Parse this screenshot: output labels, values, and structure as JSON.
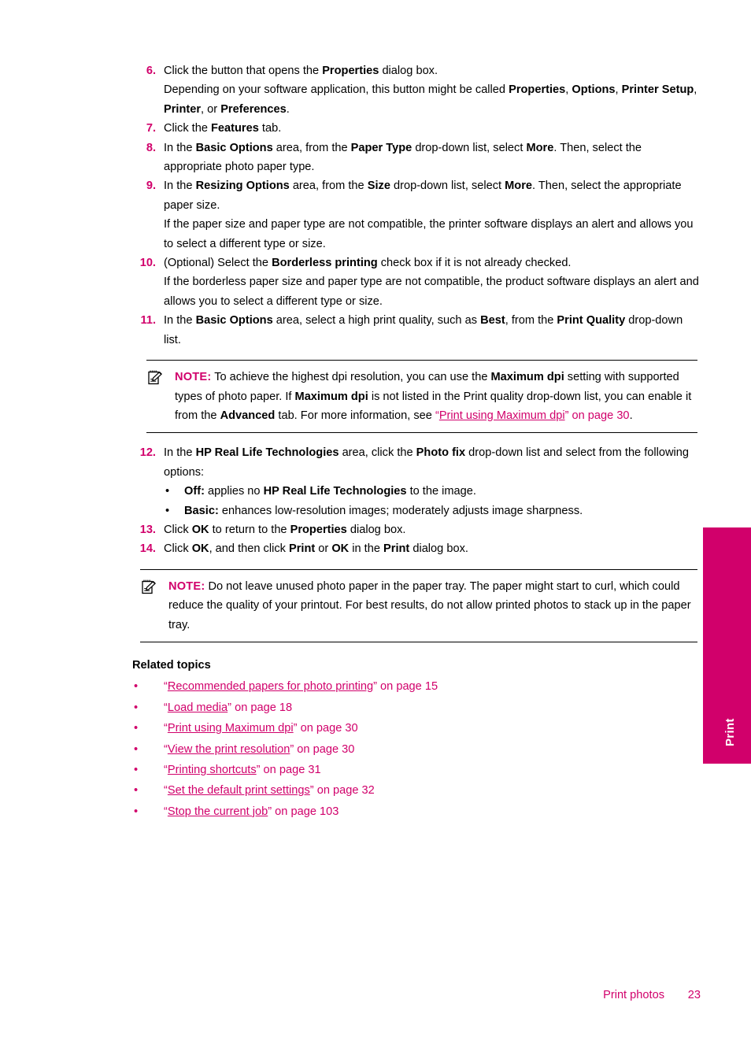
{
  "document": {
    "side_tab_label": "Print",
    "footer": {
      "section": "Print photos",
      "page_number": "23"
    },
    "accent_color": "#D1006B"
  },
  "steps": [
    {
      "number": "6.",
      "paragraphs": [
        {
          "runs": [
            {
              "t": "Click the button that opens the ",
              "b": false
            },
            {
              "t": "Properties",
              "b": true
            },
            {
              "t": " dialog box.",
              "b": false
            }
          ]
        },
        {
          "runs": [
            {
              "t": "Depending on your software application, this button might be called ",
              "b": false
            },
            {
              "t": "Properties",
              "b": true
            },
            {
              "t": ", ",
              "b": false
            },
            {
              "t": "Options",
              "b": true
            },
            {
              "t": ", ",
              "b": false
            },
            {
              "t": "Printer Setup",
              "b": true
            },
            {
              "t": ", ",
              "b": false
            },
            {
              "t": "Printer",
              "b": true
            },
            {
              "t": ", or ",
              "b": false
            },
            {
              "t": "Preferences",
              "b": true
            },
            {
              "t": ".",
              "b": false
            }
          ]
        }
      ]
    },
    {
      "number": "7.",
      "paragraphs": [
        {
          "runs": [
            {
              "t": "Click the ",
              "b": false
            },
            {
              "t": "Features",
              "b": true
            },
            {
              "t": " tab.",
              "b": false
            }
          ]
        }
      ]
    },
    {
      "number": "8.",
      "paragraphs": [
        {
          "runs": [
            {
              "t": "In the ",
              "b": false
            },
            {
              "t": "Basic Options",
              "b": true
            },
            {
              "t": " area, from the ",
              "b": false
            },
            {
              "t": "Paper Type",
              "b": true
            },
            {
              "t": " drop-down list, select ",
              "b": false
            },
            {
              "t": "More",
              "b": true
            },
            {
              "t": ". Then, select the appropriate photo paper type.",
              "b": false
            }
          ]
        }
      ]
    },
    {
      "number": "9.",
      "paragraphs": [
        {
          "runs": [
            {
              "t": "In the ",
              "b": false
            },
            {
              "t": "Resizing Options",
              "b": true
            },
            {
              "t": " area, from the ",
              "b": false
            },
            {
              "t": "Size",
              "b": true
            },
            {
              "t": " drop-down list, select ",
              "b": false
            },
            {
              "t": "More",
              "b": true
            },
            {
              "t": ". Then, select the appropriate paper size.",
              "b": false
            }
          ]
        },
        {
          "runs": [
            {
              "t": "If the paper size and paper type are not compatible, the printer software displays an alert and allows you to select a different type or size.",
              "b": false
            }
          ]
        }
      ]
    },
    {
      "number": "10.",
      "paragraphs": [
        {
          "runs": [
            {
              "t": "(Optional) Select the ",
              "b": false
            },
            {
              "t": "Borderless printing",
              "b": true
            },
            {
              "t": " check box if it is not already checked.",
              "b": false
            }
          ]
        },
        {
          "runs": [
            {
              "t": "If the borderless paper size and paper type are not compatible, the product software displays an alert and allows you to select a different type or size.",
              "b": false
            }
          ]
        }
      ]
    },
    {
      "number": "11.",
      "paragraphs": [
        {
          "runs": [
            {
              "t": "In the ",
              "b": false
            },
            {
              "t": "Basic Options",
              "b": true
            },
            {
              "t": " area, select a high print quality, such as ",
              "b": false
            },
            {
              "t": "Best",
              "b": true
            },
            {
              "t": ", from the ",
              "b": false
            },
            {
              "t": "Print Quality",
              "b": true
            },
            {
              "t": " drop-down list.",
              "b": false
            }
          ]
        }
      ]
    }
  ],
  "note_one": {
    "icon": "note-pencil-icon",
    "label": "NOTE:",
    "runs": [
      {
        "t": "  To achieve the highest dpi resolution, you can use the ",
        "b": false
      },
      {
        "t": "Maximum dpi",
        "b": true
      },
      {
        "t": " setting with supported types of photo paper. If ",
        "b": false
      },
      {
        "t": "Maximum dpi",
        "b": true
      },
      {
        "t": " is not listed in the Print quality drop-down list, you can enable it from the ",
        "b": false
      },
      {
        "t": "Advanced",
        "b": true
      },
      {
        "t": " tab. For more information, see ",
        "b": false
      }
    ],
    "link_open_quote": "“",
    "link_text": "Print using Maximum dpi",
    "link_close": "” on page 30",
    "link_period": "."
  },
  "steps_after_note": [
    {
      "number": "12.",
      "paragraphs": [
        {
          "runs": [
            {
              "t": "In the ",
              "b": false
            },
            {
              "t": "HP Real Life Technologies",
              "b": true
            },
            {
              "t": " area, click the ",
              "b": false
            },
            {
              "t": "Photo fix",
              "b": true
            },
            {
              "t": " drop-down list and select from the following options:",
              "b": false
            }
          ]
        }
      ],
      "bullets": [
        {
          "marker": "•",
          "runs": [
            {
              "t": "Off:",
              "b": true
            },
            {
              "t": " applies no ",
              "b": false
            },
            {
              "t": "HP Real Life Technologies",
              "b": true
            },
            {
              "t": " to the image.",
              "b": false
            }
          ]
        },
        {
          "marker": "•",
          "runs": [
            {
              "t": "Basic:",
              "b": true
            },
            {
              "t": " enhances low-resolution images; moderately adjusts image sharpness.",
              "b": false
            }
          ]
        }
      ]
    },
    {
      "number": "13.",
      "paragraphs": [
        {
          "runs": [
            {
              "t": "Click ",
              "b": false
            },
            {
              "t": "OK",
              "b": true
            },
            {
              "t": " to return to the ",
              "b": false
            },
            {
              "t": "Properties",
              "b": true
            },
            {
              "t": " dialog box.",
              "b": false
            }
          ]
        }
      ],
      "bullets": []
    },
    {
      "number": "14.",
      "paragraphs": [
        {
          "runs": [
            {
              "t": "Click ",
              "b": false
            },
            {
              "t": "OK",
              "b": true
            },
            {
              "t": ", and then click ",
              "b": false
            },
            {
              "t": "Print",
              "b": true
            },
            {
              "t": " or ",
              "b": false
            },
            {
              "t": "OK",
              "b": true
            },
            {
              "t": " in the ",
              "b": false
            },
            {
              "t": "Print",
              "b": true
            },
            {
              "t": " dialog box.",
              "b": false
            }
          ]
        }
      ],
      "bullets": []
    }
  ],
  "note_two": {
    "icon": "note-pencil-icon",
    "label": "NOTE:",
    "runs": [
      {
        "t": "  Do not leave unused photo paper in the paper tray. The paper might start to curl, which could reduce the quality of your printout. For best results, do not allow printed photos to stack up in the paper tray.",
        "b": false
      }
    ]
  },
  "related": {
    "heading": "Related topics",
    "items": [
      {
        "marker": "•",
        "quote_open": "“",
        "title": "Recommended papers for photo printing",
        "quote_close": "”",
        "suffix": " on page 15"
      },
      {
        "marker": "•",
        "quote_open": "“",
        "title": "Load media",
        "quote_close": "”",
        "suffix": " on page 18"
      },
      {
        "marker": "•",
        "quote_open": "“",
        "title": "Print using Maximum dpi",
        "quote_close": "”",
        "suffix": " on page 30"
      },
      {
        "marker": "•",
        "quote_open": "“",
        "title": "View the print resolution",
        "quote_close": "”",
        "suffix": " on page 30"
      },
      {
        "marker": "•",
        "quote_open": "“",
        "title": "Printing shortcuts",
        "quote_close": "”",
        "suffix": " on page 31"
      },
      {
        "marker": "•",
        "quote_open": "“",
        "title": "Set the default print settings",
        "quote_close": "”",
        "suffix": " on page 32"
      },
      {
        "marker": "•",
        "quote_open": "“",
        "title": "Stop the current job",
        "quote_close": "”",
        "suffix": " on page 103"
      }
    ]
  }
}
